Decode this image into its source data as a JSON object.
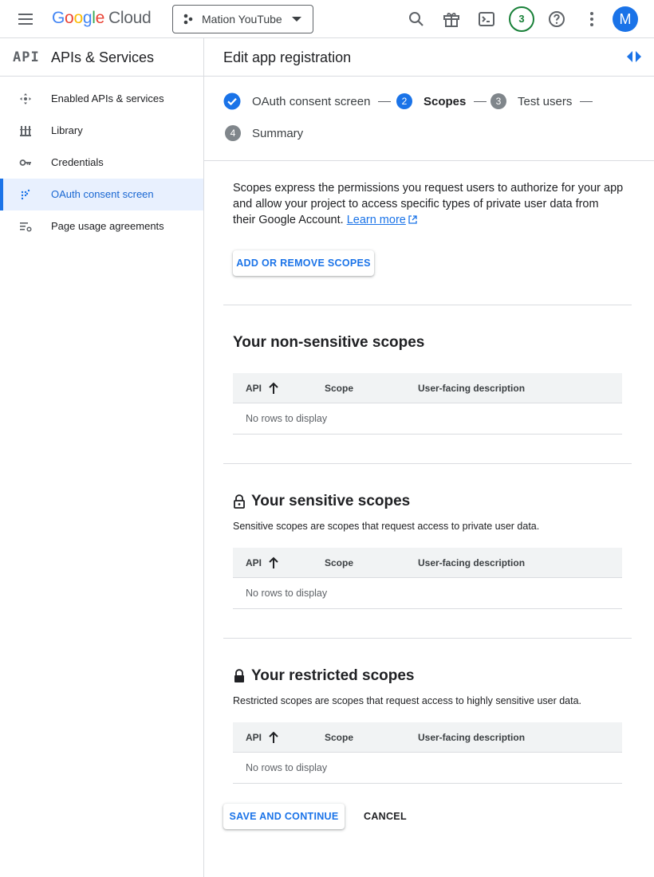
{
  "topbar": {
    "logo_google": [
      "G",
      "o",
      "o",
      "g",
      "l",
      "e"
    ],
    "logo_cloud": "Cloud",
    "project_name": "Mation YouTube",
    "notification_count": "3",
    "avatar_initial": "M"
  },
  "sidebar": {
    "logo": "API",
    "title": "APIs & Services",
    "items": [
      {
        "label": "Enabled APIs & services",
        "icon": "enabled-apis-icon"
      },
      {
        "label": "Library",
        "icon": "library-icon"
      },
      {
        "label": "Credentials",
        "icon": "key-icon"
      },
      {
        "label": "OAuth consent screen",
        "icon": "oauth-icon",
        "active": true
      },
      {
        "label": "Page usage agreements",
        "icon": "settings-list-icon"
      }
    ]
  },
  "page": {
    "title": "Edit app registration"
  },
  "stepper": {
    "steps": [
      {
        "label": "OAuth consent screen",
        "state": "done"
      },
      {
        "num": "2",
        "label": "Scopes",
        "state": "current"
      },
      {
        "num": "3",
        "label": "Test users",
        "state": "pending"
      },
      {
        "num": "4",
        "label": "Summary",
        "state": "pending"
      }
    ]
  },
  "intro": {
    "text": "Scopes express the permissions you request users to authorize for your app and allow your project to access specific types of private user data from their Google Account.",
    "link": "Learn more"
  },
  "add_scopes_button": "ADD OR REMOVE SCOPES",
  "table_columns": [
    "API",
    "Scope",
    "User-facing description"
  ],
  "empty_text": "No rows to display",
  "sections": {
    "non_sensitive": {
      "title": "Your non-sensitive scopes"
    },
    "sensitive": {
      "title": "Your sensitive scopes",
      "desc": "Sensitive scopes are scopes that request access to private user data."
    },
    "restricted": {
      "title": "Your restricted scopes",
      "desc": "Restricted scopes are scopes that request access to highly sensitive user data."
    }
  },
  "footer": {
    "save_label": "SAVE AND CONTINUE",
    "cancel_label": "CANCEL"
  },
  "colors": {
    "accent": "#1a73e8",
    "notification": "#188038",
    "active_bg": "#e8f0fe"
  }
}
